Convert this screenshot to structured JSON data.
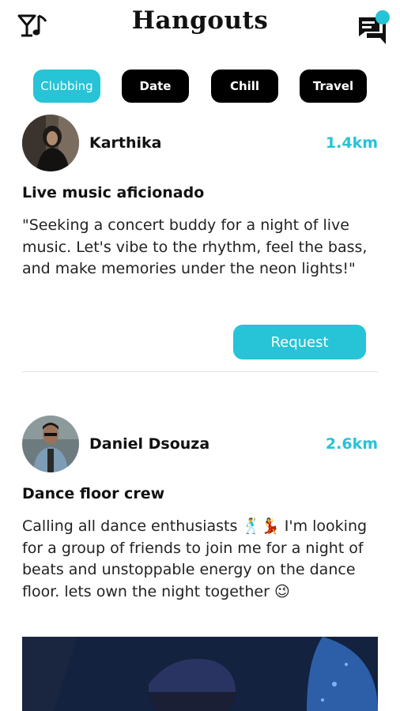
{
  "header": {
    "title": "Hangouts",
    "filter_icon": "glass-music-filter-icon",
    "chat_icon": "chat-bubbles-icon",
    "accent": "#27c3d6"
  },
  "tabs": [
    {
      "label": "Clubbing",
      "active": true
    },
    {
      "label": "Date",
      "active": false
    },
    {
      "label": "Chill",
      "active": false
    },
    {
      "label": "Travel",
      "active": false
    }
  ],
  "posts": [
    {
      "name": "Karthika",
      "distance": "1.4km",
      "title": "Live music aficionado",
      "body": " \"Seeking a concert buddy for a night of live music. Let's vibe to the rhythm, feel the bass, and make memories under the neon lights!\"",
      "button": "Request"
    },
    {
      "name": "Daniel Dsouza",
      "distance": "2.6km",
      "title": "Dance floor crew",
      "body": "Calling all dance enthusiasts 🕺💃 I'm looking for a group of friends to join me for a night of beats and unstoppable energy on the dance floor. lets own the night together 😉"
    }
  ]
}
